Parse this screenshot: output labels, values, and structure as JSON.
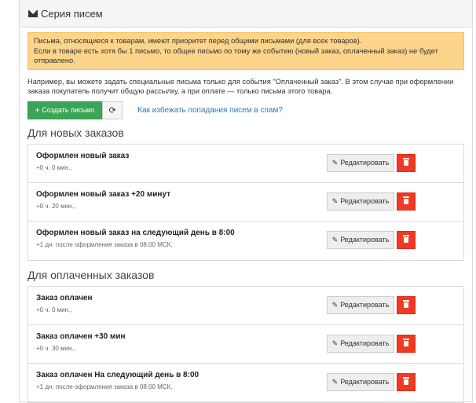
{
  "panel": {
    "title": "Серия писем"
  },
  "alert": {
    "line1": "Письма, относящиеся к товарам, имеют приоритет перед общими письмами (для всех товаров).",
    "line2": "Если в товаре есть хотя бы 1 письмо, то общее письмо по тому же событию (новый заказ, оплаченный заказ) не будет отправлено."
  },
  "note": "Например, вы можете задать специальные письма только для события \"Оплаченный заказ\". В этом случае при оформлении заказа покупатель получит общую рассылку, а при оплате — только письма этого товара.",
  "actions": {
    "create_label": "Создать письмо",
    "spam_link": "Как избежать попадания писем в спам?"
  },
  "edit_label": "Редактировать",
  "sections": [
    {
      "title": "Для новых заказов",
      "items": [
        {
          "title": "Оформлен новый заказ",
          "sub": "+0 ч. 0 мин.,"
        },
        {
          "title": "Оформлен новый заказ +20 минут",
          "sub": "+0 ч. 20 мин.,"
        },
        {
          "title": "Оформлен новый заказ на следующий день в 8:00",
          "sub": "+1 дн. после оформления заказа в 08:00 МСК,"
        }
      ]
    },
    {
      "title": "Для оплаченных заказов",
      "items": [
        {
          "title": "Заказ оплачен",
          "sub": "+0 ч. 0 мин.,"
        },
        {
          "title": "Заказ оплачен +30 мин",
          "sub": "+0 ч. 30 мин.,"
        },
        {
          "title": "Заказ оплачен На следующий день в 8:00",
          "sub": "+1 дн. после оформления заказа в 08:00 МСК,"
        }
      ]
    }
  ]
}
